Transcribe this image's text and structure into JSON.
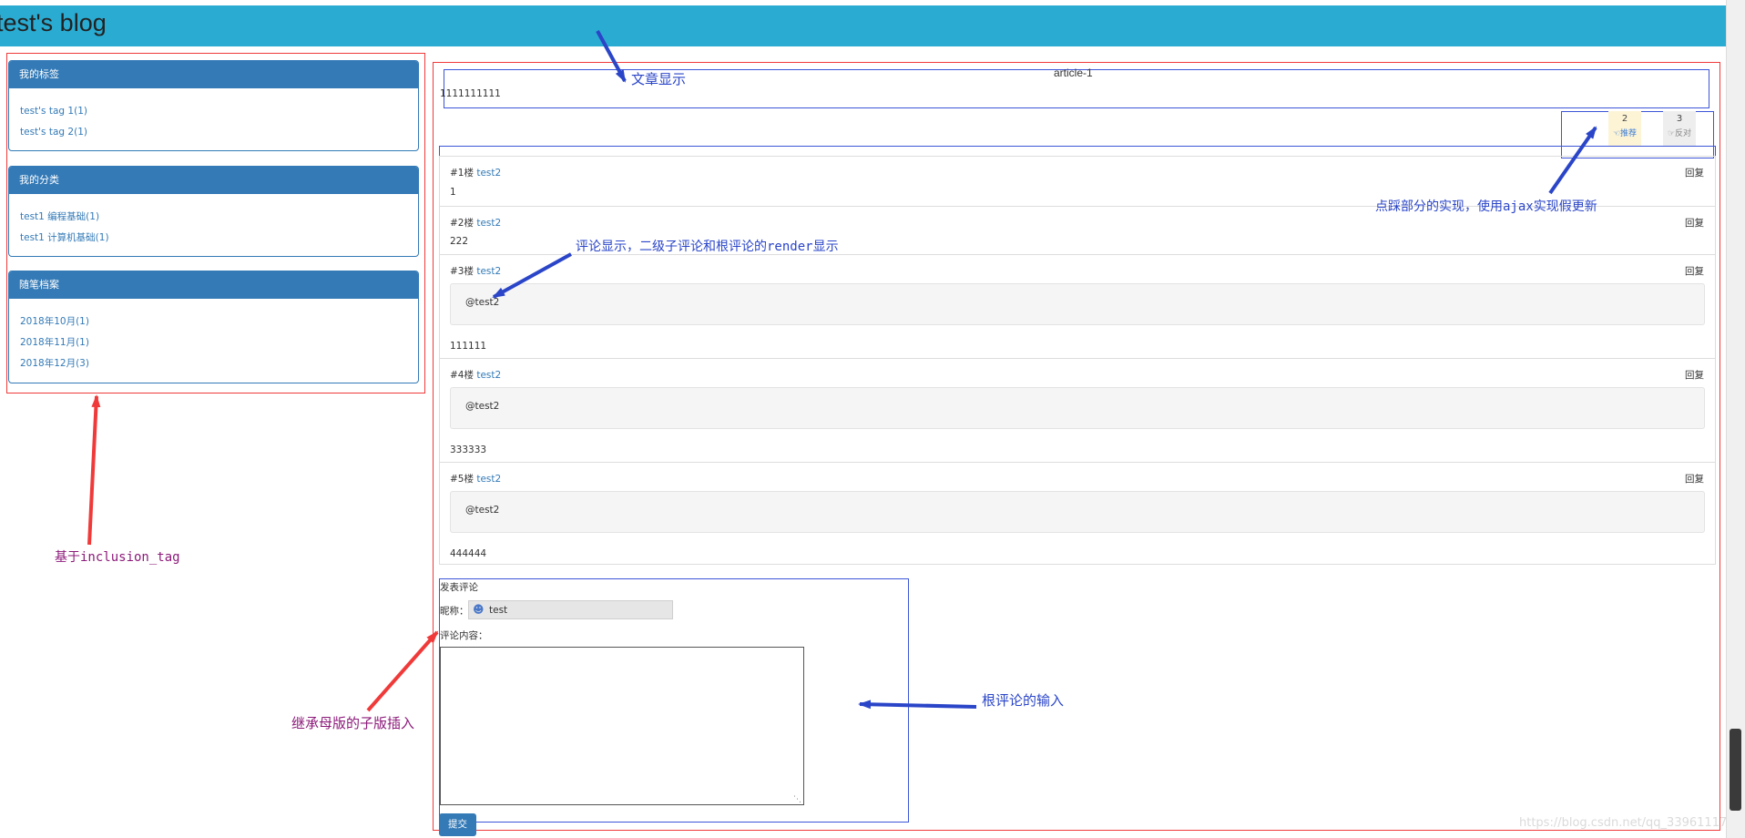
{
  "header": {
    "title": "test's blog"
  },
  "sidebar": {
    "tags": {
      "heading": "我的标签",
      "items": [
        "test's tag 1(1)",
        "test's tag 2(1)"
      ]
    },
    "categories": {
      "heading": "我的分类",
      "items": [
        "test1 编程基础(1)",
        "test1 计算机基础(1)"
      ]
    },
    "archive": {
      "heading": "随笔档案",
      "items": [
        "2018年10月(1)",
        "2018年11月(1)",
        "2018年12月(3)"
      ]
    }
  },
  "article": {
    "title": "article-1",
    "content": "1111111111"
  },
  "votes": {
    "up": {
      "count": "2",
      "label": "推荐"
    },
    "down": {
      "count": "3",
      "label": "反对"
    }
  },
  "comments": [
    {
      "floor": "#1楼",
      "user": "test2",
      "reply": "回复",
      "quote": "",
      "text": "1"
    },
    {
      "floor": "#2楼",
      "user": "test2",
      "reply": "回复",
      "quote": "",
      "text": "222"
    },
    {
      "floor": "#3楼",
      "user": "test2",
      "reply": "回复",
      "quote": "@test2",
      "text": "111111"
    },
    {
      "floor": "#4楼",
      "user": "test2",
      "reply": "回复",
      "quote": "@test2",
      "text": "333333"
    },
    {
      "floor": "#5楼",
      "user": "test2",
      "reply": "回复",
      "quote": "@test2",
      "text": "444444"
    }
  ],
  "form": {
    "heading": "发表评论",
    "nickname_label": "昵称：",
    "nickname_value": "test",
    "content_label": "评论内容：",
    "submit_label": "提交"
  },
  "annotations": {
    "article_display": "文章显示",
    "vote_impl": "点踩部分的实现，使用ajax实现假更新",
    "comment_display": "评论显示，二级子评论和根评论的render显示",
    "inclusion_tag": "基于inclusion_tag",
    "inherit": "继承母版的子版插入",
    "root_input": "根评论的输入"
  },
  "watermark": "https://blog.csdn.net/qq_33961117",
  "colors": {
    "header": "#2aabd2",
    "panel": "#337ab7",
    "annotation_red": "#f03a3a",
    "annotation_blue": "#3c55d8"
  }
}
